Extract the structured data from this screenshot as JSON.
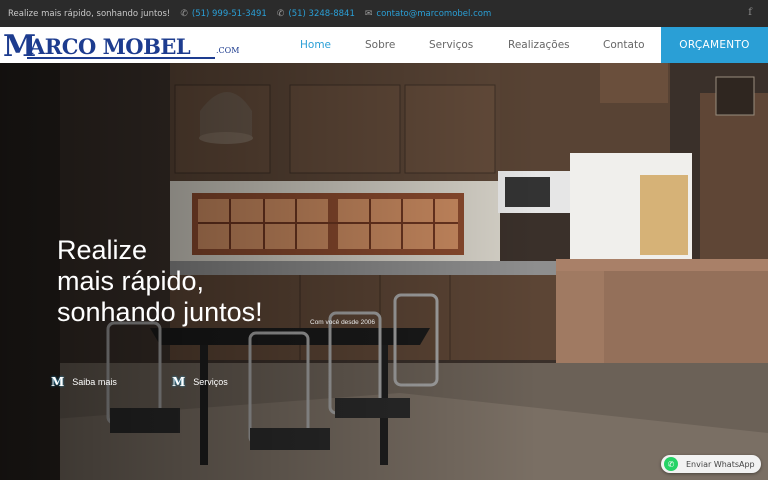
{
  "topbar": {
    "tagline": "Realize mais rápido, sonhando juntos!",
    "phone1": "(51) 999-51-3491",
    "phone2": "(51) 3248-8841",
    "email": "contato@marcomobel.com",
    "phone_icon": "phone-icon",
    "email_icon": "envelope-icon",
    "social_icon": "facebook-icon",
    "facebook_glyph": "f"
  },
  "logo": {
    "initial": "M",
    "name": "ARCO MOBEL",
    "suffix": ".COM"
  },
  "nav": {
    "items": [
      "Home",
      "Sobre",
      "Serviços",
      "Realizações",
      "Contato"
    ],
    "active": "Home",
    "cta": "ORÇAMENTO"
  },
  "hero": {
    "headline": [
      "Realize",
      "mais rápido,",
      "sonhando juntos!"
    ],
    "since": "Com você desde 2006",
    "links": [
      {
        "icon": "M",
        "label": "Saiba mais"
      },
      {
        "icon": "M",
        "label": "Serviços"
      }
    ]
  },
  "whatsapp": {
    "label": "Enviar WhatsApp",
    "icon": "whatsapp-icon"
  },
  "colors": {
    "accent": "#2a9fd6",
    "brand": "#1d3c8f",
    "topbar_bg": "#2b2b2b",
    "whatsapp": "#25d366"
  }
}
